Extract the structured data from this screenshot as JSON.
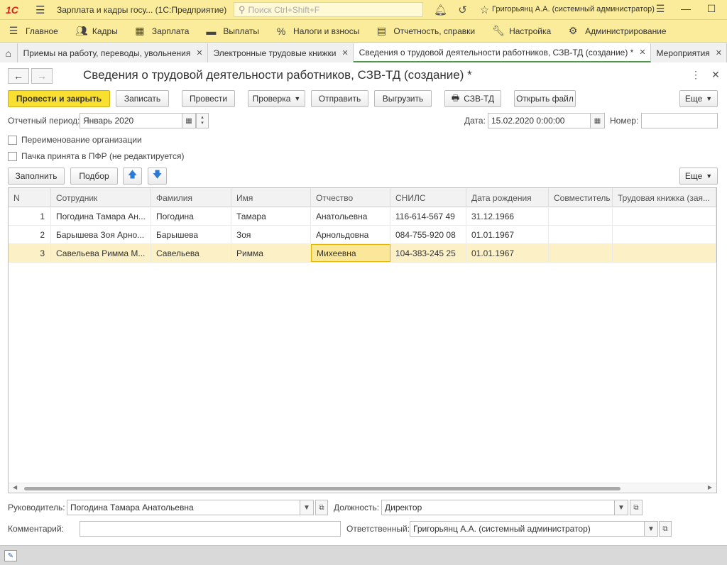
{
  "titlebar": {
    "app_title": "Зарплата и кадры госу... (1С:Предприятие)",
    "search_placeholder": "Поиск Ctrl+Shift+F",
    "user": "Григорьянц А.А. (системный администратор)"
  },
  "sections": [
    {
      "label": "Главное",
      "icon": "menu-icon"
    },
    {
      "label": "Кадры",
      "icon": "people-icon"
    },
    {
      "label": "Зарплата",
      "icon": "calculator-icon"
    },
    {
      "label": "Выплаты",
      "icon": "wallet-icon"
    },
    {
      "label": "Налоги и взносы",
      "icon": "percent-icon"
    },
    {
      "label": "Отчетность, справки",
      "icon": "report-icon"
    },
    {
      "label": "Настройка",
      "icon": "wrench-icon"
    },
    {
      "label": "Администрирование",
      "icon": "gear-icon"
    }
  ],
  "tabs": [
    {
      "label": "Приемы на работу, переводы, увольнения"
    },
    {
      "label": "Электронные трудовые книжки"
    },
    {
      "label": "Сведения о трудовой деятельности работников, СЗВ-ТД (создание) *"
    },
    {
      "label": "Мероприятия"
    }
  ],
  "form": {
    "title": "Сведения о трудовой деятельности работников, СЗВ-ТД (создание) *",
    "buttons": {
      "post_close": "Провести и закрыть",
      "save": "Записать",
      "post": "Провести",
      "check": "Проверка",
      "send": "Отправить",
      "export": "Выгрузить",
      "szv_td": "СЗВ-ТД",
      "open_file": "Открыть файл",
      "more": "Еще"
    },
    "period_label": "Отчетный период:",
    "period_value": "Январь 2020",
    "date_label": "Дата:",
    "date_value": "15.02.2020  0:00:00",
    "number_label": "Номер:",
    "number_value": "",
    "rename_org_label": "Переименование организации",
    "pack_accepted_label": "Пачка принята в ПФР (не редактируется)"
  },
  "table_toolbar": {
    "fill": "Заполнить",
    "select": "Подбор",
    "more": "Еще"
  },
  "table": {
    "columns": [
      "N",
      "Сотрудник",
      "Фамилия",
      "Имя",
      "Отчество",
      "СНИЛС",
      "Дата рождения",
      "Совместитель",
      "Трудовая книжка (зая..."
    ],
    "rows": [
      [
        "1",
        "Погодина Тамара Ан...",
        "Погодина",
        "Тамара",
        "Анатольевна",
        "116-614-567 49",
        "31.12.1966",
        "",
        ""
      ],
      [
        "2",
        "Барышева Зоя Арно...",
        "Барышева",
        "Зоя",
        "Арнольдовна",
        "084-755-920 08",
        "01.01.1967",
        "",
        ""
      ],
      [
        "3",
        "Савельева Римма М...",
        "Савельева",
        "Римма",
        "Михеевна",
        "104-383-245 25",
        "01.01.1967",
        "",
        ""
      ]
    ]
  },
  "footer": {
    "head_label": "Руководитель:",
    "head_value": "Погодина Тамара Анатольевна",
    "position_label": "Должность:",
    "position_value": "Директор",
    "comment_label": "Комментарий:",
    "comment_value": "",
    "responsible_label": "Ответственный:",
    "responsible_value": "Григорьянц А.А. (системный администратор)"
  }
}
